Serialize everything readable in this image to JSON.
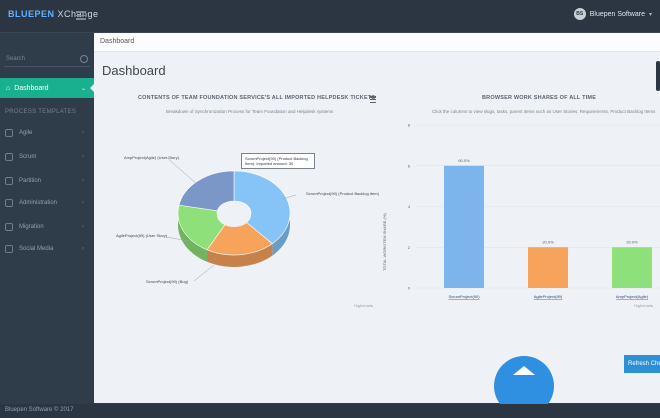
{
  "app": {
    "logo_a": "BLUE",
    "logo_b": "PEN",
    "logo_c": "XChange",
    "user_initials": "BS",
    "user_name": "Bluepen Software"
  },
  "sidebar": {
    "search_placeholder": "Search",
    "active_item": "Dashboard",
    "section_title": "PROCESS TEMPLATES",
    "items": [
      {
        "label": "Agile"
      },
      {
        "label": "Scrum"
      },
      {
        "label": "Partition"
      },
      {
        "label": "Administration"
      },
      {
        "label": "Migration"
      },
      {
        "label": "Social Media"
      }
    ]
  },
  "breadcrumb": "Dashboard",
  "page_title": "Dashboard",
  "refresh_label": "Refresh Che",
  "footer": "Bluepen Software © 2017",
  "chart_data": [
    {
      "type": "pie",
      "title": "CONTENTS OF TEAM FOUNDATION SERVICE'S ALL IMPORTED HELPDESK TICKETS",
      "subtitle": "Breakdown of Synchronization Process for Team Foundation and Helpdesk systems",
      "labels": [
        "ScrumProject(90) (Product Backlog Item)",
        "ScrumProject(90) (Bug)",
        "AgileProject(89) (User Story)",
        "AmpProject(Agile) (User Story)"
      ],
      "values": [
        38,
        20,
        20,
        22
      ],
      "colors": [
        "#86c3f7",
        "#f7a35c",
        "#8fe07a",
        "#7b97c7"
      ],
      "tooltip": "ScrumProject(90) (Product Backlog Item): Imported amount: 30",
      "credit": "Highcharts"
    },
    {
      "type": "bar",
      "title": "BROWSER WORK SHARES OF ALL TIME",
      "subtitle": "Click the columns to view slugs, tasks, parent items such as User Stories, Requirements, Product Backlog Items",
      "ylabel": "TOTAL WORKITEM SHARE (%)",
      "ylim": [
        0,
        8
      ],
      "yticks": [
        0,
        2,
        4,
        6,
        8
      ],
      "categories": [
        "ScrumProject(90)",
        "AgileProject(89)",
        "AmpProject(Agile)"
      ],
      "values": [
        6,
        2,
        2
      ],
      "value_labels": [
        "60.0%",
        "20.0%",
        "20.0%"
      ],
      "colors": [
        "#7db4ec",
        "#f7a35c",
        "#8ee07a"
      ],
      "credit": "Highcharts"
    }
  ]
}
